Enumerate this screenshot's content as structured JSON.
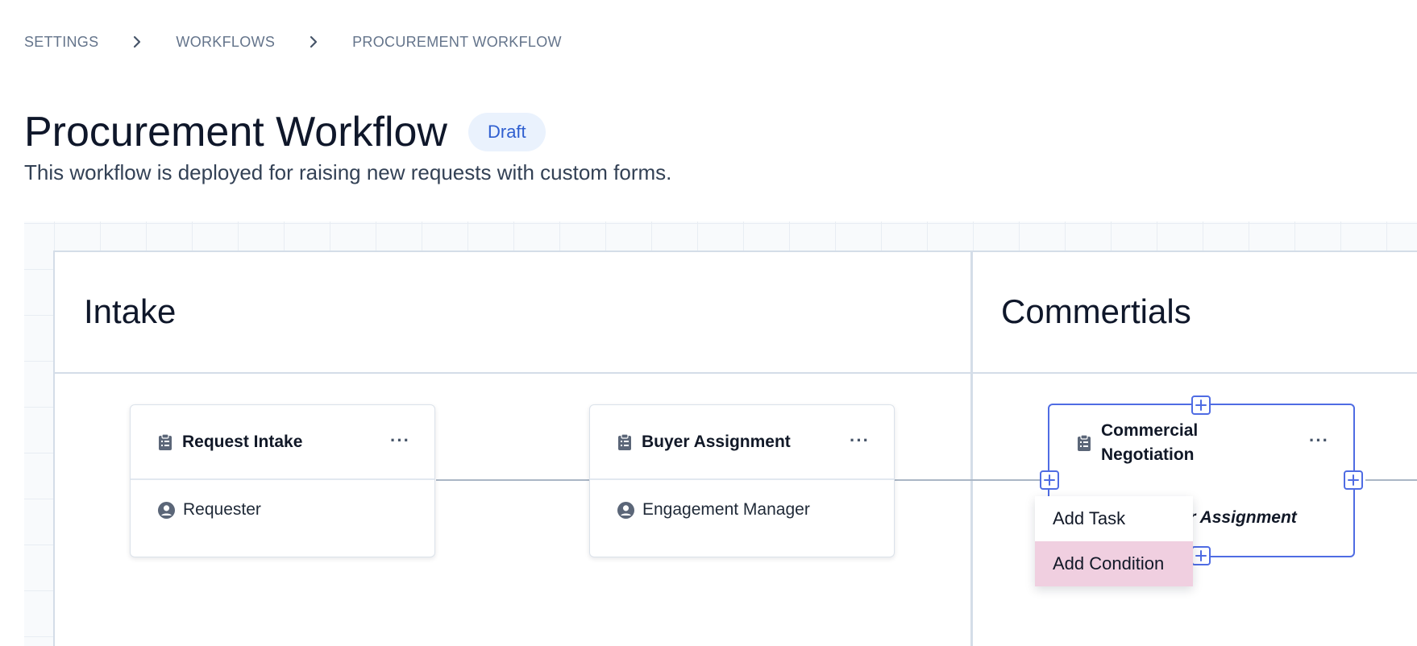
{
  "breadcrumb": {
    "items": [
      "SETTINGS",
      "WORKFLOWS",
      "PROCUREMENT WORKFLOW"
    ]
  },
  "page": {
    "title": "Procurement Workflow",
    "badge": "Draft",
    "description": "This workflow is deployed for raising new requests with custom forms."
  },
  "lanes": [
    {
      "title": "Intake"
    },
    {
      "title": "Commertials"
    }
  ],
  "cards": [
    {
      "title": "Request Intake",
      "assignee": "Requester",
      "menu": "···"
    },
    {
      "title": "Buyer Assignment",
      "assignee": "Engagement Manager",
      "menu": "···"
    },
    {
      "title_line1": "Commercial",
      "title_line2": "Negotiation",
      "assignee": "yer Assignment",
      "menu": "···"
    }
  ],
  "dropdown": {
    "items": [
      "Add Task",
      "Add Condition"
    ],
    "highlighted": "Add Condition"
  },
  "colors": {
    "accent": "#4f6ce3",
    "badge_bg": "#eaf2fd",
    "badge_text": "#2f5fd0",
    "highlight": "#f0cfe0"
  },
  "icons": {
    "breadcrumb_separator": "chevron-right-icon",
    "task": "clipboard-icon",
    "assignee": "user-circle-icon",
    "menu": "more-horizontal-icon",
    "add": "plus-icon"
  }
}
